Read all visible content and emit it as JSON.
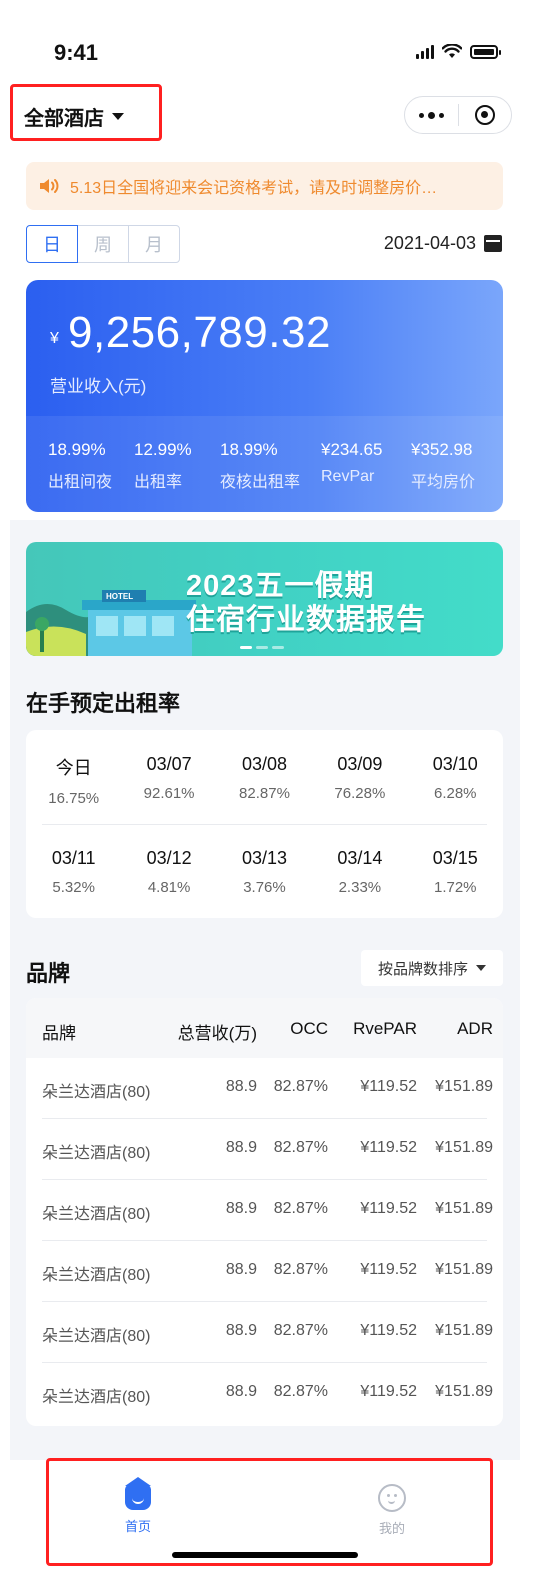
{
  "status_bar": {
    "time": "9:41"
  },
  "header": {
    "hotel_selector": "全部酒店"
  },
  "notice": {
    "text": "5.13日全国将迎来会记资格考试，请及时调整房价…"
  },
  "period_tabs": [
    {
      "label": "日",
      "active": true
    },
    {
      "label": "周",
      "active": false
    },
    {
      "label": "月",
      "active": false
    }
  ],
  "date": "2021-04-03",
  "revenue": {
    "currency": "¥",
    "amount": "9,256,789.32",
    "label": "营业收入(元)",
    "kpis": [
      {
        "value": "18.99%",
        "label": "出租间夜"
      },
      {
        "value": "12.99%",
        "label": "出租率"
      },
      {
        "value": "18.99%",
        "label": "夜核出租率"
      },
      {
        "value": "¥234.65",
        "label": "RevPar"
      },
      {
        "value": "¥352.98",
        "label": "平均房价"
      }
    ]
  },
  "banner": {
    "line1": "2023五一假期",
    "line2": "住宿行业数据报告",
    "sign": "HOTEL"
  },
  "occupancy": {
    "title": "在手预定出租率",
    "rows": [
      [
        {
          "date": "今日",
          "pct": "16.75%"
        },
        {
          "date": "03/07",
          "pct": "92.61%"
        },
        {
          "date": "03/08",
          "pct": "82.87%"
        },
        {
          "date": "03/09",
          "pct": "76.28%"
        },
        {
          "date": "03/10",
          "pct": "6.28%"
        }
      ],
      [
        {
          "date": "03/11",
          "pct": "5.32%"
        },
        {
          "date": "03/12",
          "pct": "4.81%"
        },
        {
          "date": "03/13",
          "pct": "3.76%"
        },
        {
          "date": "03/14",
          "pct": "2.33%"
        },
        {
          "date": "03/15",
          "pct": "1.72%"
        }
      ]
    ]
  },
  "brand": {
    "title": "品牌",
    "sort_label": "按品牌数排序",
    "columns": [
      "品牌",
      "总营收(万)",
      "OCC",
      "RvePAR",
      "ADR"
    ],
    "rows": [
      [
        "朵兰达酒店(80)",
        "88.9",
        "82.87%",
        "¥119.52",
        "¥151.89"
      ],
      [
        "朵兰达酒店(80)",
        "88.9",
        "82.87%",
        "¥119.52",
        "¥151.89"
      ],
      [
        "朵兰达酒店(80)",
        "88.9",
        "82.87%",
        "¥119.52",
        "¥151.89"
      ],
      [
        "朵兰达酒店(80)",
        "88.9",
        "82.87%",
        "¥119.52",
        "¥151.89"
      ],
      [
        "朵兰达酒店(80)",
        "88.9",
        "82.87%",
        "¥119.52",
        "¥151.89"
      ],
      [
        "朵兰达酒店(80)",
        "88.9",
        "82.87%",
        "¥119.52",
        "¥151.89"
      ]
    ]
  },
  "tabbar": [
    {
      "label": "首页",
      "active": true,
      "icon": "home-icon"
    },
    {
      "label": "我的",
      "active": false,
      "icon": "profile-icon"
    }
  ],
  "colors": {
    "accent": "#2f6ff2",
    "notice_text": "#ef8a2e",
    "highlight_box": "#ff2020"
  }
}
